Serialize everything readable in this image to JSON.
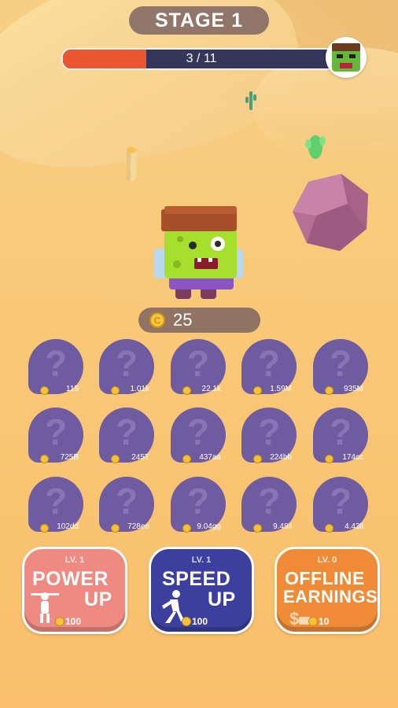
{
  "header": {
    "stage_label": "STAGE 1"
  },
  "progress": {
    "text": "3 / 11",
    "fraction": 0.3
  },
  "boss": {
    "icon": "zombie-boss-icon"
  },
  "wallet": {
    "coins": "25"
  },
  "shop_slots": [
    {
      "price": "115"
    },
    {
      "price": "1.01k"
    },
    {
      "price": "22.1k"
    },
    {
      "price": "1.59M"
    },
    {
      "price": "935M"
    },
    {
      "price": "725B"
    },
    {
      "price": "245T"
    },
    {
      "price": "437aa"
    },
    {
      "price": "224bb"
    },
    {
      "price": "174cc"
    },
    {
      "price": "102dd"
    },
    {
      "price": "728ee"
    },
    {
      "price": "9.04gg"
    },
    {
      "price": "9.48ii"
    },
    {
      "price": "4.43ll"
    }
  ],
  "upgrades": {
    "power": {
      "level": "LV. 1",
      "line1": "POWER",
      "line2": "UP",
      "cost": "100",
      "color": "#ef8a82"
    },
    "speed": {
      "level": "LV. 1",
      "line1": "SPEED",
      "line2": "UP",
      "cost": "100",
      "color": "#3d3f9e"
    },
    "offline": {
      "level": "LV. 0",
      "line1": "OFFLINE",
      "line2": "EARNINGS",
      "cost": "10",
      "color": "#ef8b37"
    }
  },
  "colors": {
    "sand": "#f8c978",
    "slot": "#6e5ba0",
    "pill": "#7a6060",
    "progress_fill": "#e9562f"
  }
}
